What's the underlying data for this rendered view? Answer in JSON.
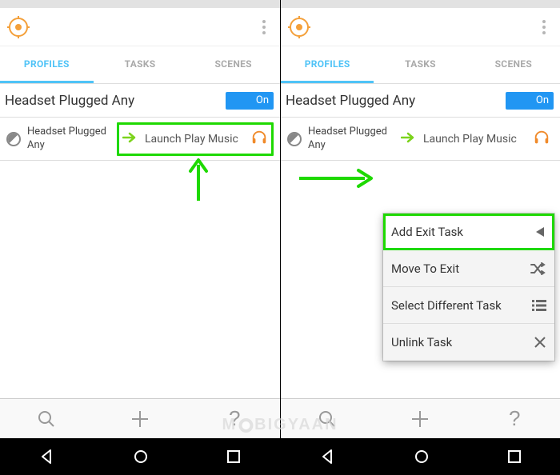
{
  "tabs": {
    "profiles": "PROFILES",
    "tasks": "TASKS",
    "scenes": "SCENES"
  },
  "section": {
    "title": "Headset Plugged Any",
    "toggle": "On"
  },
  "profile": {
    "condition": "Headset Plugged Any",
    "task": "Launch Play Music"
  },
  "popup": {
    "add_exit": "Add Exit Task",
    "move_to_exit": "Move To Exit",
    "select_different": "Select Different Task",
    "unlink": "Unlink Task"
  },
  "icons": {
    "magnifier": "search-icon",
    "plus": "plus-icon",
    "question": "question-icon"
  },
  "watermark": "M   BIGYAAN"
}
